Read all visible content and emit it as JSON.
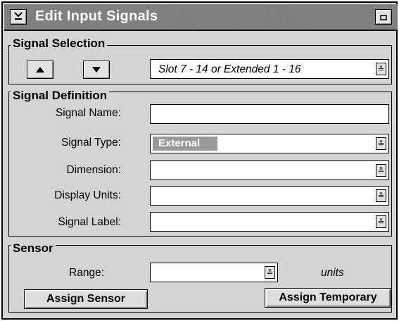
{
  "window": {
    "title": "Edit Input Signals",
    "menu_icon": "chevron-down-icon",
    "maximize_icon": "maximize-icon"
  },
  "signal_selection": {
    "group_title": "Signal Selection",
    "up_icon": "triangle-up-icon",
    "down_icon": "triangle-down-icon",
    "slot_value": "Slot 7 - 14  or Extended 1 - 16"
  },
  "signal_definition": {
    "group_title": "Signal Definition",
    "name_label": "Signal Name:",
    "name_value": "",
    "type_label": "Signal Type:",
    "type_value": "External",
    "dimension_label": "Dimension:",
    "dimension_value": "",
    "units_label": "Display Units:",
    "units_value": "",
    "signal_label_label": "Signal Label:",
    "signal_label_value": ""
  },
  "sensor": {
    "group_title": "Sensor",
    "range_label": "Range:",
    "range_value": "",
    "units_text": "units",
    "assign_sensor_label": "Assign Sensor",
    "assign_temporary_label": "Assign Temporary"
  },
  "colors": {
    "titlebar": "#7d7d7d",
    "panel": "#d4d4d4",
    "selected_chip": "#9a9a9a"
  }
}
